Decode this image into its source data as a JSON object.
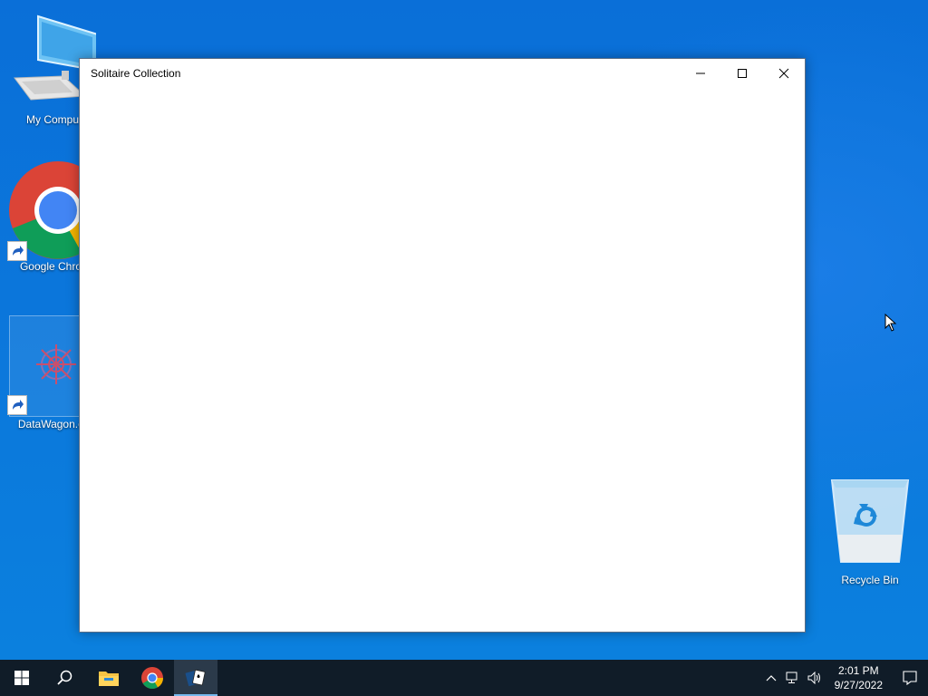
{
  "desktop": {
    "icons": [
      {
        "label": "My Compu",
        "icon": "computer-icon"
      },
      {
        "label": "Google Chro",
        "icon": "chrome-icon"
      },
      {
        "label": "DataWagon.c",
        "icon": "datawagon-icon"
      },
      {
        "label": "Recycle Bin",
        "icon": "recycle-bin-icon"
      }
    ]
  },
  "window": {
    "title": "Solitaire Collection",
    "controls": [
      "minimize",
      "maximize",
      "close"
    ]
  },
  "taskbar": {
    "buttons": [
      "start-icon",
      "search-icon",
      "file-explorer-icon",
      "chrome-icon",
      "solitaire-icon"
    ],
    "active": "solitaire-icon",
    "clock": {
      "time": "2:01 PM",
      "date": "9/27/2022"
    },
    "tray": [
      "chevron-up-icon",
      "network-icon",
      "volume-icon",
      "notification-icon"
    ]
  },
  "colors": {
    "desktop_bg": "#0b76db",
    "taskbar_bg": "#101c28",
    "active_indicator": "#76b9ed"
  }
}
